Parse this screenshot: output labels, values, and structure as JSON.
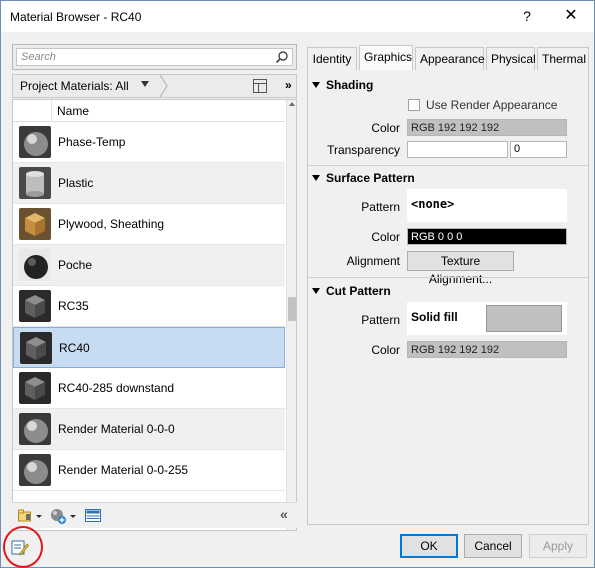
{
  "window": {
    "title": "Material Browser - RC40",
    "help_label": "?",
    "close_label": "✕"
  },
  "search": {
    "placeholder": "Search"
  },
  "filter": {
    "label": "Project Materials: All",
    "expand_label": "»"
  },
  "list": {
    "header": "Name",
    "items": [
      {
        "label": "Phase-Temp",
        "thumb": "sphere-gray"
      },
      {
        "label": "Plastic",
        "thumb": "cylinder-gray"
      },
      {
        "label": "Plywood, Sheathing",
        "thumb": "cube-wood"
      },
      {
        "label": "Poche",
        "thumb": "sphere-dark"
      },
      {
        "label": "RC35",
        "thumb": "cube-concrete"
      },
      {
        "label": "RC40",
        "thumb": "cube-concrete",
        "selected": true
      },
      {
        "label": "RC40-285 downstand",
        "thumb": "cube-concrete"
      },
      {
        "label": "Render Material 0-0-0",
        "thumb": "sphere-gray"
      },
      {
        "label": "Render Material 0-0-255",
        "thumb": "sphere-gray"
      }
    ]
  },
  "left_toolbar": {
    "collapse_label": "«"
  },
  "tabs": [
    "Identity",
    "Graphics",
    "Appearance",
    "Physical",
    "Thermal"
  ],
  "active_tab": "Graphics",
  "shading": {
    "header": "Shading",
    "use_render_label": "Use Render Appearance",
    "use_render_checked": false,
    "color_label": "Color",
    "color_value": "RGB 192 192 192",
    "color_hex": "#c0c0c0",
    "transparency_label": "Transparency",
    "transparency_value": "0"
  },
  "surface_pattern": {
    "header": "Surface Pattern",
    "pattern_label": "Pattern",
    "pattern_value": "<none>",
    "color_label": "Color",
    "color_value": "RGB 0 0 0",
    "color_hex": "#000000",
    "alignment_label": "Alignment",
    "alignment_button": "Texture Alignment..."
  },
  "cut_pattern": {
    "header": "Cut Pattern",
    "pattern_label": "Pattern",
    "pattern_value": "Solid fill",
    "color_label": "Color",
    "color_value": "RGB 192 192 192",
    "color_hex": "#c0c0c0"
  },
  "footer": {
    "ok_label": "OK",
    "cancel_label": "Cancel",
    "apply_label": "Apply"
  }
}
